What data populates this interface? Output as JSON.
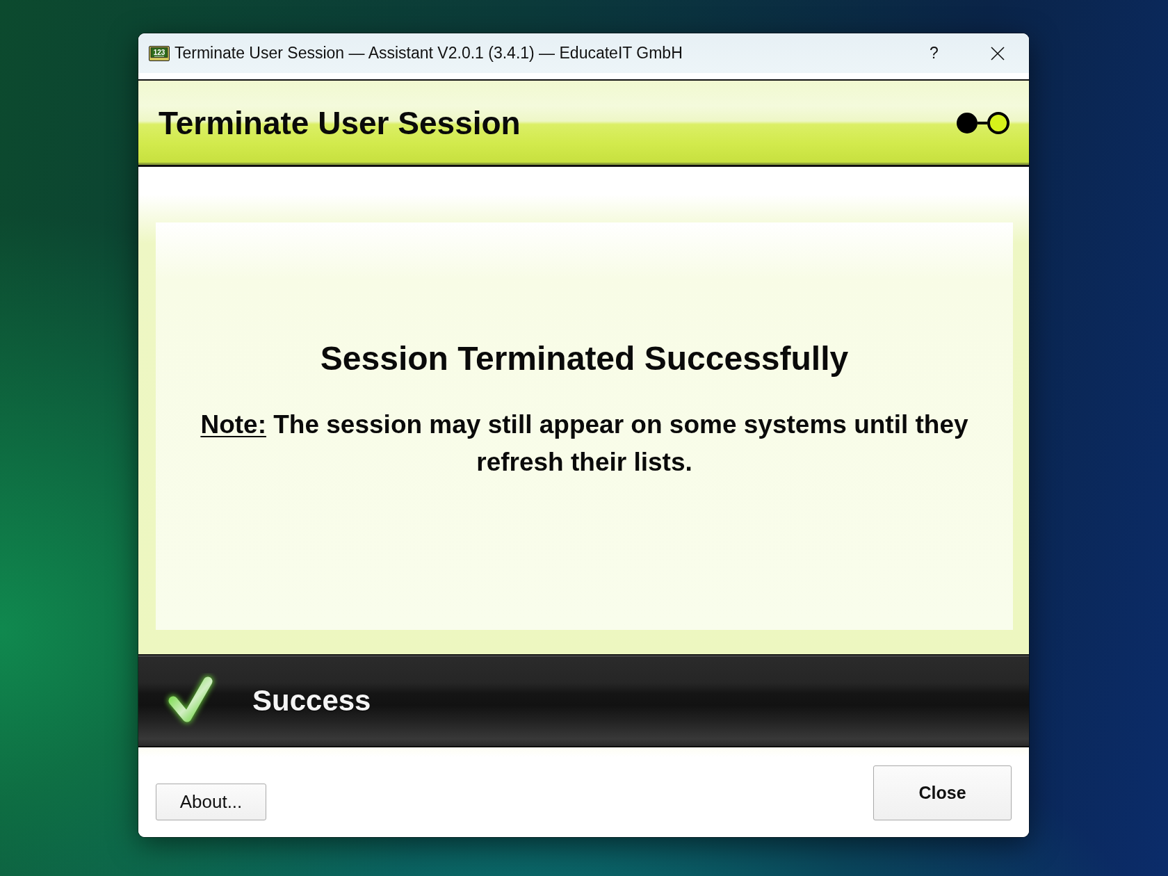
{
  "window": {
    "icon_text": "123",
    "title": "Terminate User Session — Assistant V2.0.1 (3.4.1) — EducateIT GmbH",
    "title_buttons": [
      {
        "kind": "help",
        "label": "?"
      },
      {
        "kind": "close"
      }
    ]
  },
  "header": {
    "title": "Terminate User Session",
    "steps": [
      {
        "selected": false
      },
      {
        "selected": true
      }
    ]
  },
  "message": {
    "heading": "Session Terminated Successfully",
    "note_label": "Note:",
    "note_text": "The session may still appear on some systems until they refresh their lists."
  },
  "status_banner": {
    "kind": "success",
    "label": "Success"
  },
  "buttons": [
    {
      "kind": "secondary",
      "label": "About..."
    },
    {
      "kind": "default",
      "label": "Close"
    }
  ]
}
